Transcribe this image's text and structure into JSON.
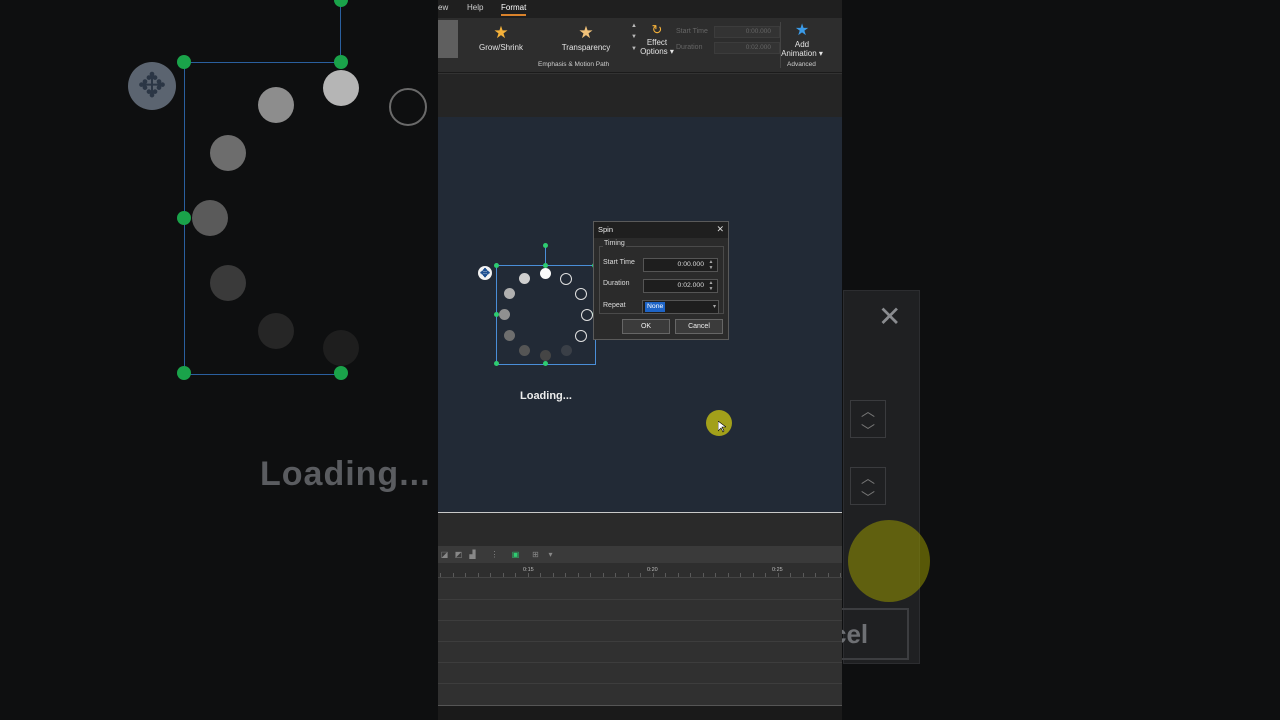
{
  "menu": {
    "partial_view": "ew",
    "help": "Help",
    "format": "Format"
  },
  "ribbon": {
    "grow_shrink": "Grow/Shrink",
    "transparency": "Transparency",
    "effect_options_line1": "Effect",
    "effect_options_line2": "Options",
    "start_time_label": "Start Time",
    "start_time_value": "0:00.000",
    "duration_label": "Duration",
    "duration_value": "0:02.000",
    "add_animation_line1": "Add",
    "add_animation_line2": "Animation",
    "group_emphasis": "Emphasis & Motion Path",
    "group_advanced": "Advanced"
  },
  "slide": {
    "loading_text": "Loading..."
  },
  "dialog": {
    "title": "Spin",
    "group": "Timing",
    "start_time_label": "Start Time",
    "start_time_value": "0:00.000",
    "duration_label": "Duration",
    "duration_value": "0:02.000",
    "repeat_label": "Repeat",
    "repeat_value": "None",
    "ok": "OK",
    "cancel": "Cancel"
  },
  "timeline": {
    "ticks": [
      "0:15",
      "0:20",
      "0:25"
    ]
  },
  "background": {
    "loading_text": "Loading...",
    "cancel_partial": "cel"
  },
  "colors": {
    "accent_tab": "#d9822b",
    "selection": "#4a8ed8",
    "handle": "#2ecc71",
    "highlight": "#1d64c7",
    "cursor": "#c3be14"
  },
  "icons": [
    "move-icon",
    "star-icon",
    "effect-options-icon",
    "add-animation-icon",
    "close-icon",
    "spin-arrows-icon",
    "dropdown-arrow-icon"
  ]
}
